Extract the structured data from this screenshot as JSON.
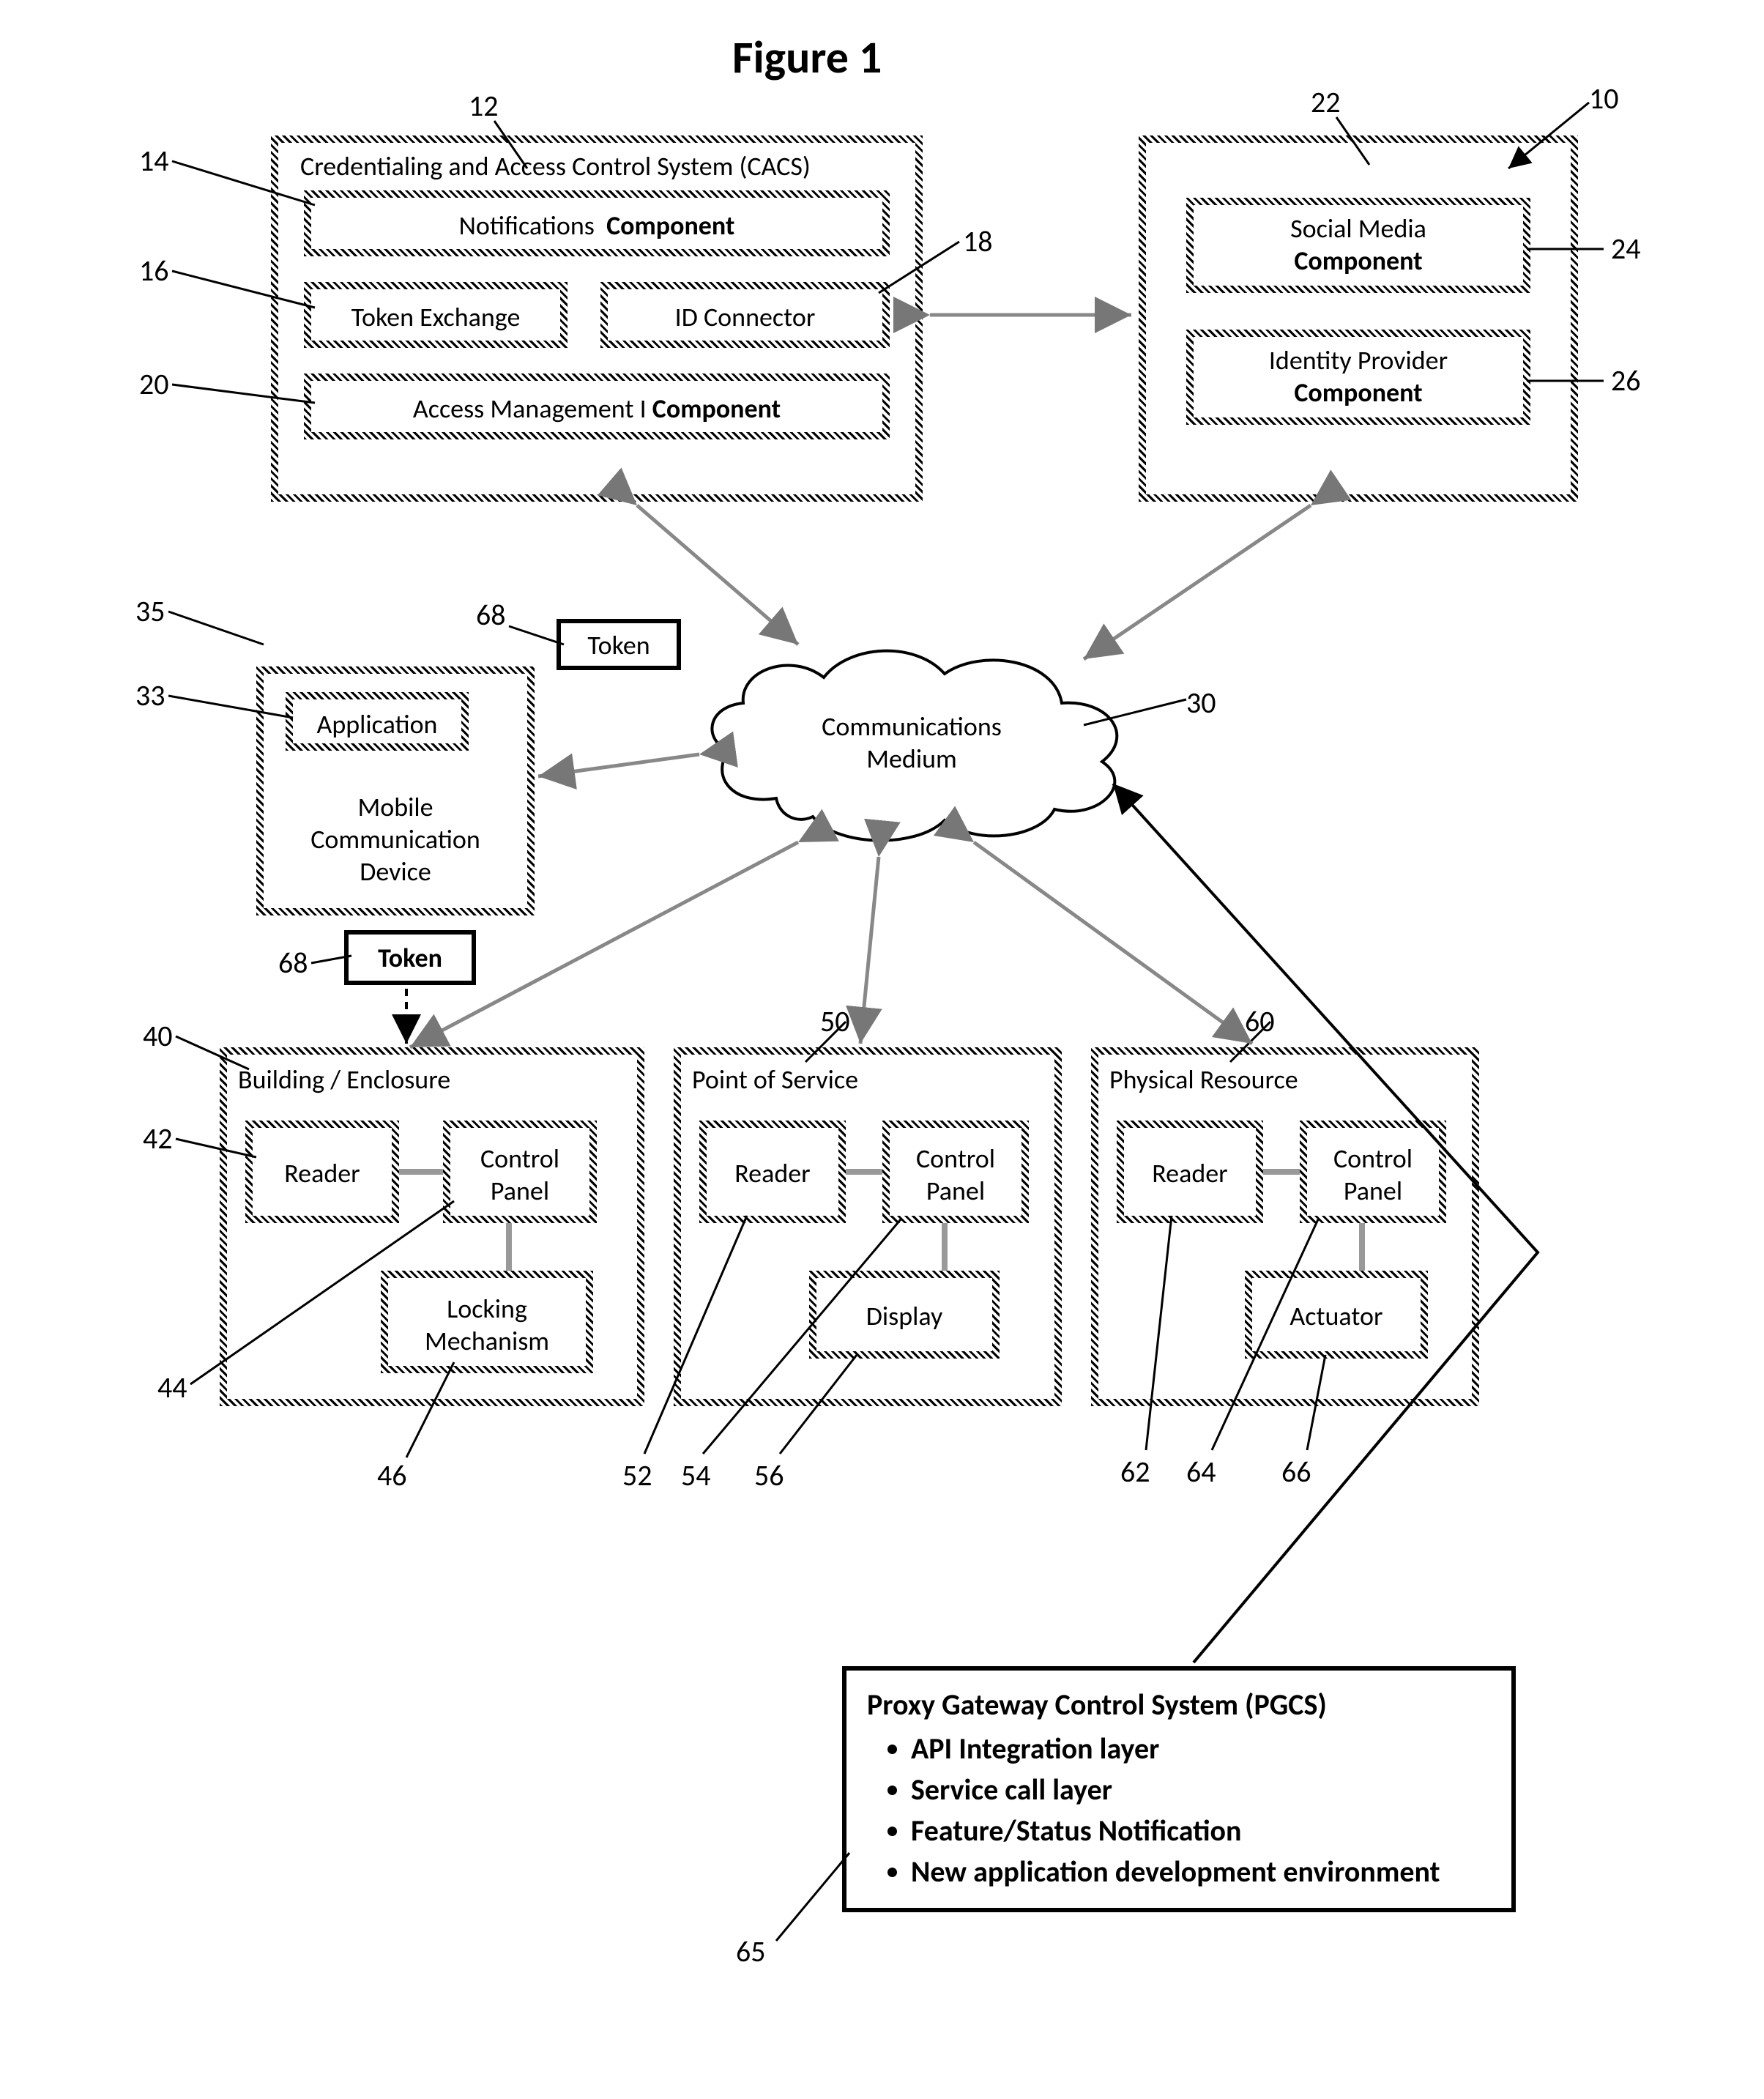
{
  "title": "Figure 1",
  "refs": {
    "r10": "10",
    "r12": "12",
    "r14": "14",
    "r16": "16",
    "r18": "18",
    "r20": "20",
    "r22": "22",
    "r24": "24",
    "r26": "26",
    "r30": "30",
    "r33": "33",
    "r35": "35",
    "r40": "40",
    "r42": "42",
    "r44": "44",
    "r46": "46",
    "r50": "50",
    "r52": "52",
    "r54": "54",
    "r56": "56",
    "r60": "60",
    "r62": "62",
    "r64": "64",
    "r66": "66",
    "r65": "65",
    "r68a": "68",
    "r68b": "68"
  },
  "cacs": {
    "title": "Credentialing and Access Control System (CACS)",
    "notifications_a": "Notifications",
    "notifications_b": "Component",
    "token_exchange": "Token Exchange",
    "id_connector": "ID Connector",
    "access_mgmt_a": "Access Management I",
    "access_mgmt_b": "Component"
  },
  "ext": {
    "social_a": "Social Media",
    "social_b": "Component",
    "idp_a": "Identity Provider",
    "idp_b": "Component"
  },
  "tokens": {
    "label1": "Token",
    "label2": "Token"
  },
  "mobile": {
    "app": "Application",
    "line1": "Mobile",
    "line2": "Communication",
    "line3": "Device"
  },
  "cloud": "Communications Medium",
  "building": {
    "title": "Building / Enclosure",
    "reader": "Reader",
    "panel": "Control Panel",
    "lock": "Locking Mechanism"
  },
  "pos": {
    "title": "Point of Service",
    "reader": "Reader",
    "panel": "Control Panel",
    "display": "Display"
  },
  "phys": {
    "title": "Physical Resource",
    "reader": "Reader",
    "panel": "Control Panel",
    "actuator": "Actuator"
  },
  "pgcs": {
    "title": "Proxy Gateway Control System (PGCS)",
    "b1": "API Integration layer",
    "b2": "Service call layer",
    "b3": "Feature/Status Notification",
    "b4": "New application development environment"
  }
}
